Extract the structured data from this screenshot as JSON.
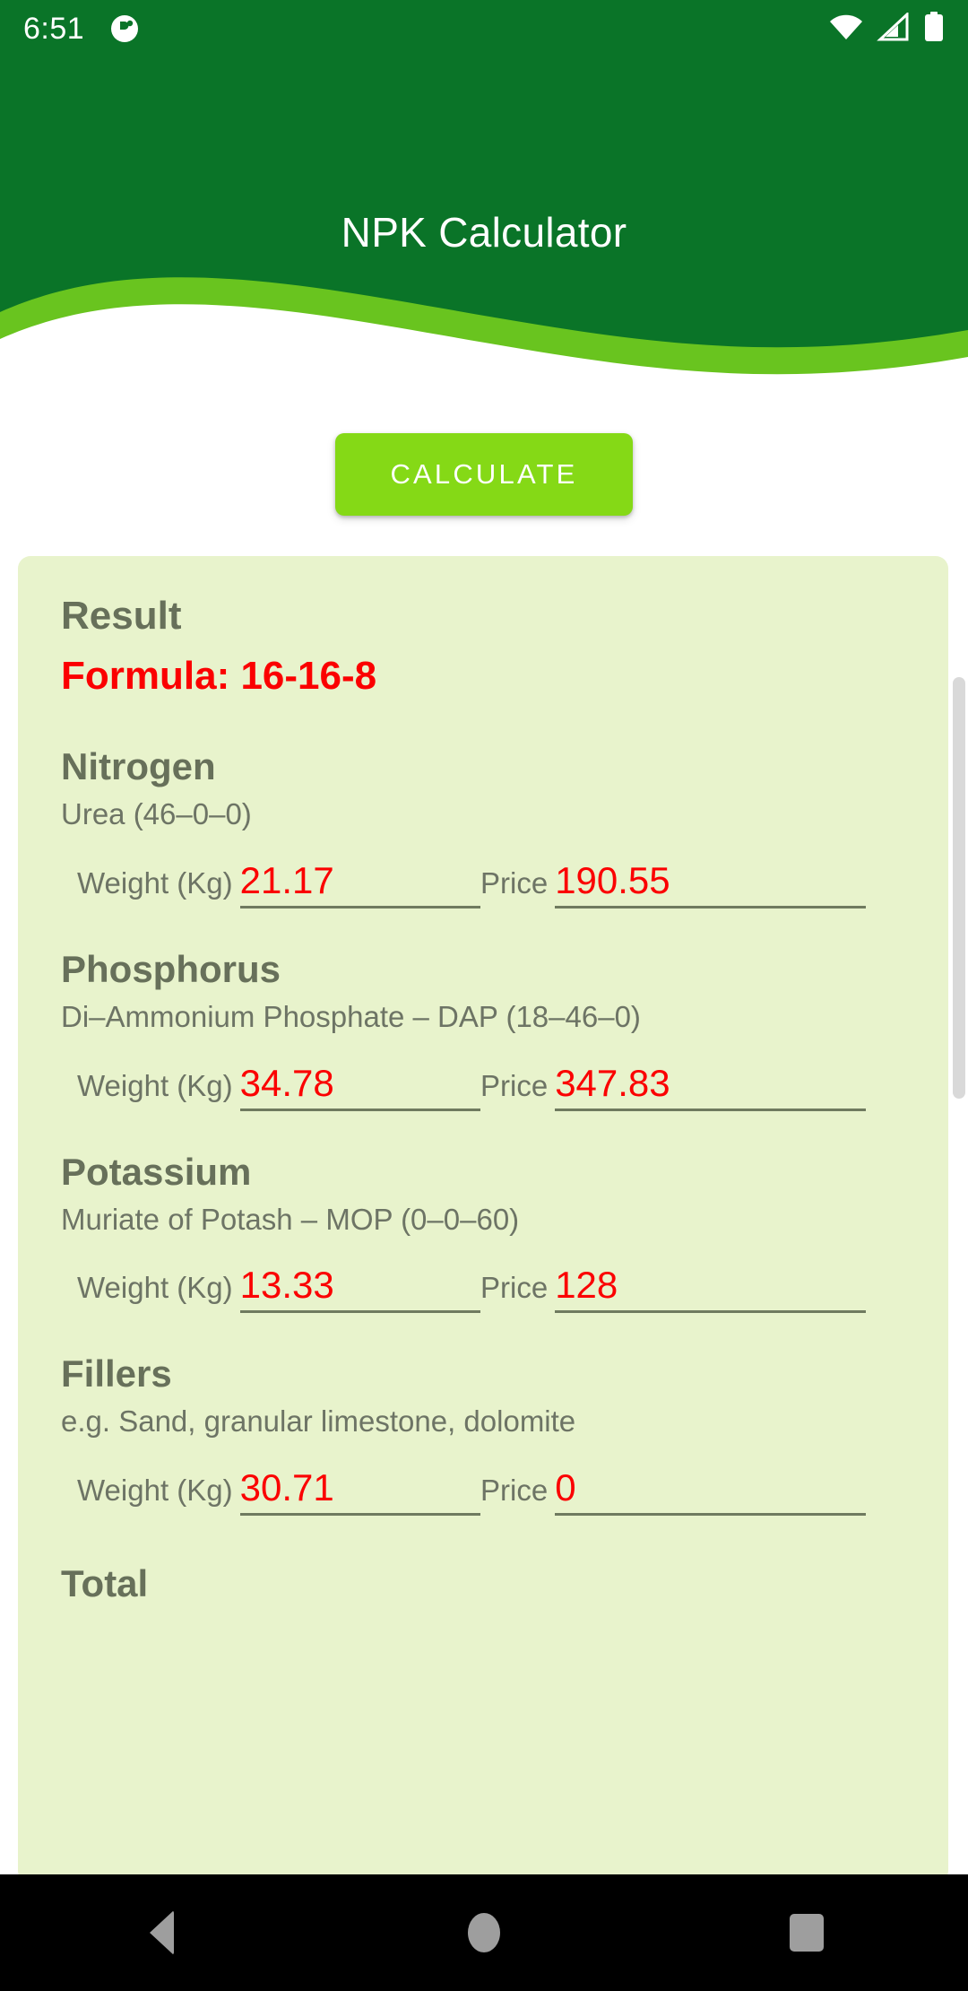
{
  "status_bar": {
    "time": "6:51",
    "icons": [
      "notification-dot-icon",
      "wifi-icon",
      "cellular-signal-icon",
      "battery-icon"
    ]
  },
  "header": {
    "title": "NPK Calculator",
    "bg_color": "#0a7428",
    "wave_color": "#69c41f"
  },
  "actions": {
    "calculate_label": "CALCULATE",
    "calculate_color": "#85d916"
  },
  "result": {
    "title": "Result",
    "formula_label": "Formula: 16-16-8",
    "formula_color": "#fb0000",
    "card_color": "#e8f3cc",
    "total_label": "Total",
    "weight_label": "Weight (Kg)",
    "price_label": "Price",
    "nutrients": [
      {
        "name": "Nitrogen",
        "source": "Urea (46–0–0)",
        "weight": "21.17",
        "price": "190.55"
      },
      {
        "name": "Phosphorus",
        "source": "Di–Ammonium Phosphate – DAP (18–46–0)",
        "weight": "34.78",
        "price": "347.83"
      },
      {
        "name": "Potassium",
        "source": "Muriate of Potash – MOP (0–0–60)",
        "weight": "13.33",
        "price": "128"
      },
      {
        "name": "Fillers",
        "source": "e.g. Sand, granular limestone, dolomite",
        "weight": "30.71",
        "price": "0"
      }
    ]
  },
  "nav_bar": {
    "back": "back-button",
    "home": "home-button",
    "recents": "recents-button"
  }
}
